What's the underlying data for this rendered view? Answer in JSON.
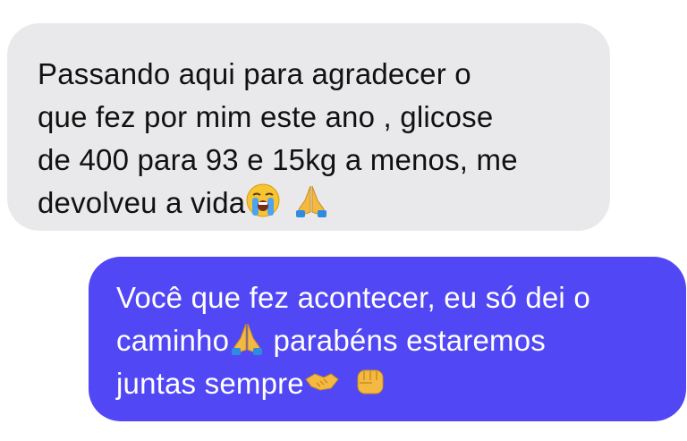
{
  "conversation": {
    "incoming": {
      "lines": [
        "Passando aqui para agradecer o",
        "que fez por mim este ano , glicose",
        "de 400 para 93 e 15kg a menos, me",
        "devolveu a vida"
      ],
      "trailing_emojis": [
        "crying-face-icon",
        "folded-hands-icon"
      ]
    },
    "outgoing": {
      "lines": [
        "Você que fez acontecer, eu só dei o",
        "caminho",
        " parabéns estaremos",
        "juntas sempre"
      ],
      "emojis": [
        "folded-hands-icon",
        "handshake-icon",
        "fist-icon"
      ]
    }
  },
  "colors": {
    "incoming_bubble": "#e9e9eb",
    "outgoing_bubble": "#5147f5",
    "incoming_text": "#111111",
    "outgoing_text": "#ffffff"
  }
}
